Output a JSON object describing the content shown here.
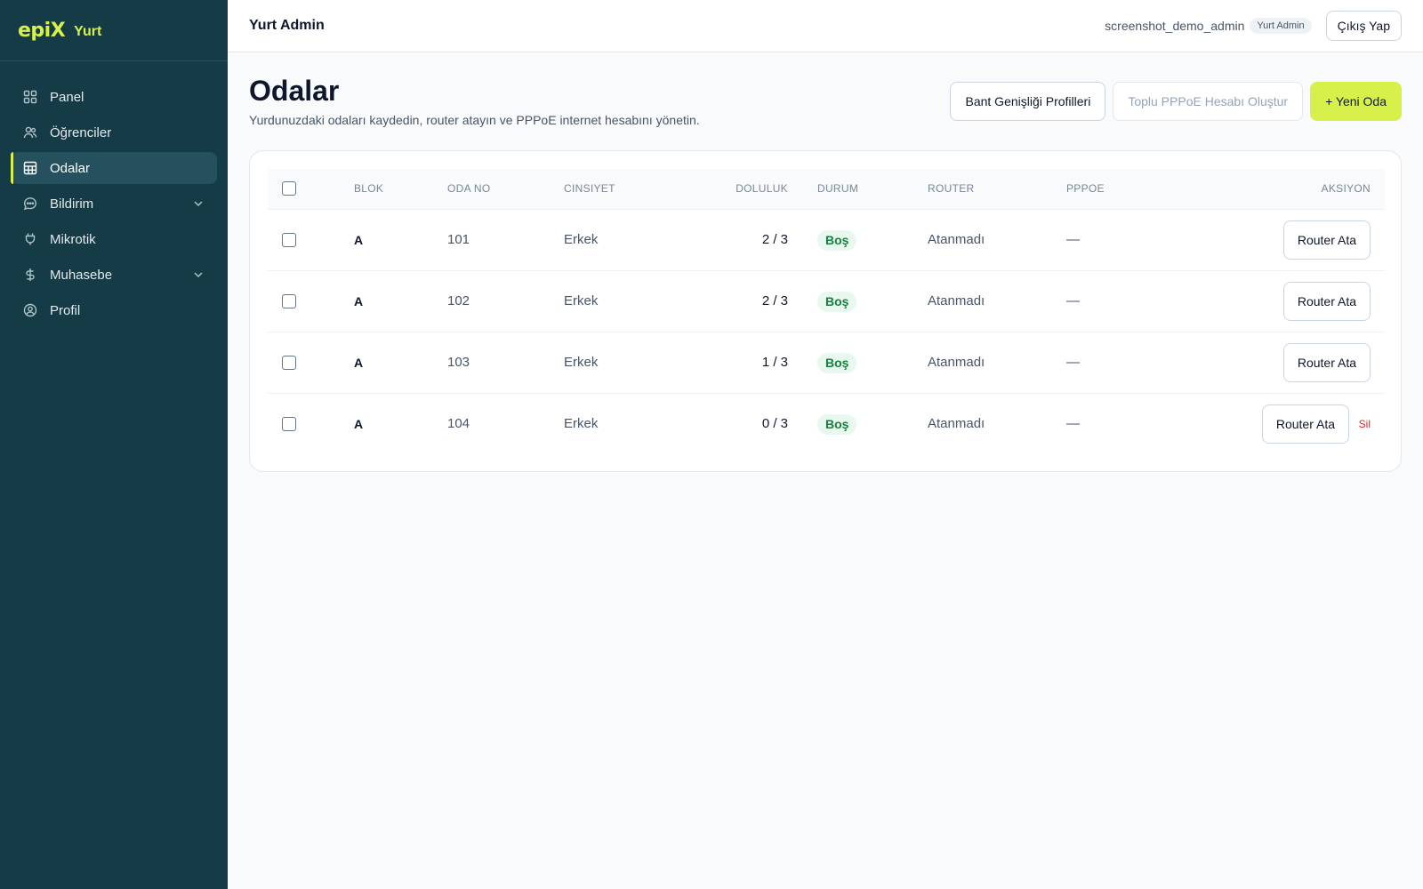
{
  "brand": {
    "logo": "epiX",
    "name": "Yurt",
    "accent": "#d8f04a"
  },
  "sidebar": {
    "items": [
      {
        "label": "Panel",
        "icon": "grid-icon",
        "active": false
      },
      {
        "label": "Öğrenciler",
        "icon": "users-icon",
        "active": false
      },
      {
        "label": "Odalar",
        "icon": "table-icon",
        "active": true
      },
      {
        "label": "Bildirim",
        "icon": "chat-icon",
        "active": false,
        "expandable": true
      },
      {
        "label": "Mikrotik",
        "icon": "plug-icon",
        "active": false
      },
      {
        "label": "Muhasebe",
        "icon": "dollar-icon",
        "active": false,
        "expandable": true
      },
      {
        "label": "Profil",
        "icon": "user-circle-icon",
        "active": false
      }
    ]
  },
  "topbar": {
    "title": "Yurt Admin",
    "user": "screenshot_demo_admin",
    "role": "Yurt Admin",
    "logout_label": "Çıkış Yap"
  },
  "page": {
    "title": "Odalar",
    "subtitle": "Yurdunuzdaki odaları kaydedin, router atayın ve PPPoE internet hesabını yönetin.",
    "actions": {
      "bandwidth_label": "Bant Genişliği Profilleri",
      "bulk_pppoe_label": "Toplu PPPoE Hesabı Oluştur",
      "new_room_label": "+ Yeni Oda"
    }
  },
  "table": {
    "headers": {
      "block": "BLOK",
      "room_no": "ODA NO",
      "gender": "CINSIYET",
      "occupancy": "DOLULUK",
      "status": "DURUM",
      "router": "ROUTER",
      "pppoe": "PPPOE",
      "action": "AKSIYON"
    },
    "rows": [
      {
        "block": "A",
        "room_no": "101",
        "gender": "Erkek",
        "occupancy": "2 / 3",
        "status": "Boş",
        "router": "Atanmadı",
        "pppoe": "—",
        "action_label": "Router Ata",
        "delete_label": ""
      },
      {
        "block": "A",
        "room_no": "102",
        "gender": "Erkek",
        "occupancy": "2 / 3",
        "status": "Boş",
        "router": "Atanmadı",
        "pppoe": "—",
        "action_label": "Router Ata",
        "delete_label": ""
      },
      {
        "block": "A",
        "room_no": "103",
        "gender": "Erkek",
        "occupancy": "1 / 3",
        "status": "Boş",
        "router": "Atanmadı",
        "pppoe": "—",
        "action_label": "Router Ata",
        "delete_label": ""
      },
      {
        "block": "A",
        "room_no": "104",
        "gender": "Erkek",
        "occupancy": "0 / 3",
        "status": "Boş",
        "router": "Atanmadı",
        "pppoe": "—",
        "action_label": "Router Ata",
        "delete_label": "Sil"
      }
    ]
  },
  "colors": {
    "sidebar_bg": "#153b47",
    "accent": "#d8f04a",
    "status_ok": "#15803d",
    "danger": "#dc2626"
  }
}
